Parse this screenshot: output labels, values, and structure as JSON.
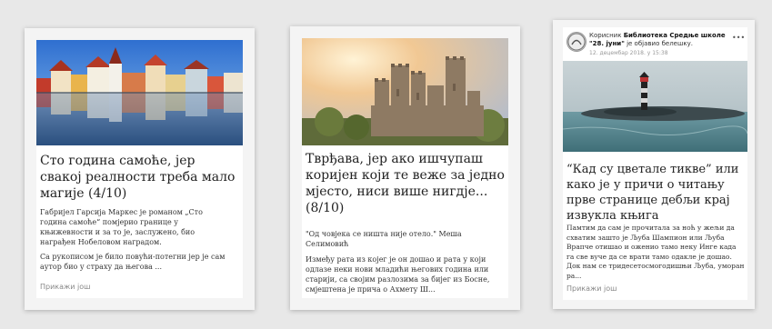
{
  "cards": [
    {
      "title": "Сто година самоће, јер свакој реалности треба мало магије (4/10)",
      "paragraphs": [
        "Габријел Гарсија Маркес је романом „Сто година самоће“ помјерио границе у књижевности и за то је, заслужено, био награђен Нобеловом наградом.",
        "Са рукописом је било повући-потегни јер је сам аутор био у страху да његова ..."
      ],
      "more": "Прикажи још"
    },
    {
      "title": "Тврђава, јер ако ишчупаш коријен који те веже за једно мјесто, ниси више нигдје... (8/10)",
      "paragraphs": [
        "\"Од човјека се ништа није отело.\" Меша Селимовић",
        "Између рата из којег је он дошао и рата у који одлазе неки нови младићи његових година или старији, са својим разлозима за бијег из Босне, смјештена је прича о Ахмету Ш..."
      ],
      "more": ""
    },
    {
      "post_header": {
        "prefix": "Корисник",
        "author": "Библиотека Средње школе \"28. јуни\"",
        "suffix": "је објавио белешку.",
        "date": "12. децембар 2018. у 15:38",
        "menu": "•••"
      },
      "title": "“Кад су цветале тикве” или како је у причи о читању прве странице дебљи крај извукла књига",
      "paragraphs": [
        "Памтим да сам је прочитала за ноћ у жељи да схватим зашто је Љуба Шампион или Љуба Врапче отишао и оженио тамо неку Инге када га све вуче да се врати тамо одакле је дошао. Док нам се тридесетосмогодишњи Љуба, уморан ра..."
      ],
      "more": "Прикажи још"
    }
  ]
}
